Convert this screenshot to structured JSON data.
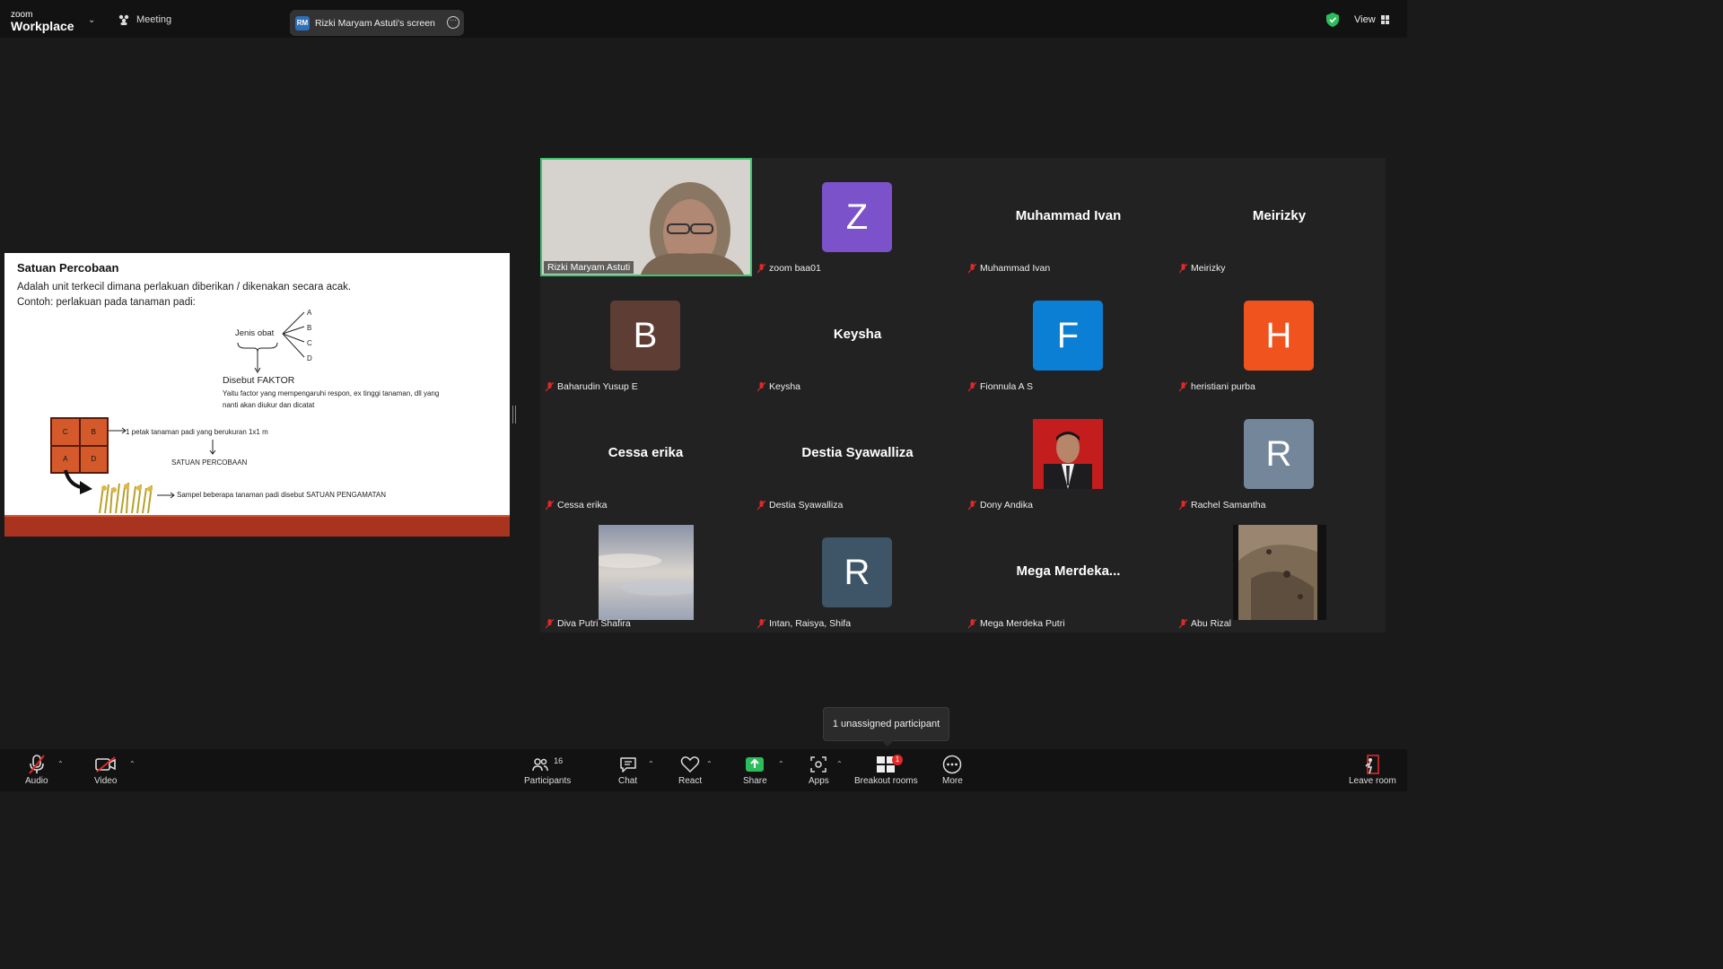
{
  "topbar": {
    "logo_small": "zoom",
    "logo_big": "Workplace",
    "meeting_label": "Meeting",
    "screen_badge": "RM",
    "screen_label": "Rizki Maryam Astuti's screen",
    "view_label": "View"
  },
  "slide": {
    "title": "Satuan Percobaan",
    "line1": "Adalah unit terkecil dimana perlakuan diberikan / dikenakan secara acak.",
    "line2": "Contoh: perlakuan pada tanaman padi:",
    "jenis_obat": "Jenis obat",
    "options": [
      "A",
      "B",
      "C",
      "D"
    ],
    "disebut_faktor": "Disebut FAKTOR",
    "faktor_desc1": "Yaitu factor yang mempengaruhi respon, ex tinggi tanaman, dll yang",
    "faktor_desc2": "nanti akan diukur dan dicatat",
    "plot_cells": [
      "C",
      "B",
      "A",
      "D"
    ],
    "petak_label": "1 petak tanaman padi yang berukuran 1x1 m",
    "satuan_percobaan": "SATUAN PERCOBAAN",
    "sampel_label": "Sampel beberapa tanaman padi disebut SATUAN PENGAMATAN"
  },
  "gallery": {
    "tiles": [
      {
        "name": "Rizki Maryam Astuti",
        "type": "video"
      },
      {
        "name": "zoom baa01",
        "avatar": "Z",
        "color": "#7b52c9"
      },
      {
        "name": "Muhammad Ivan",
        "display": "Muhammad Ivan"
      },
      {
        "name": "Meirizky",
        "display": "Meirizky"
      },
      {
        "name": "Baharudin Yusup E",
        "avatar": "B",
        "color": "#5e3e34"
      },
      {
        "name": "Keysha",
        "display": "Keysha"
      },
      {
        "name": "Fionnula A S",
        "avatar": "F",
        "color": "#0b7fd4"
      },
      {
        "name": "heristiani purba",
        "avatar": "H",
        "color": "#f0531e"
      },
      {
        "name": "Cessa erika",
        "display": "Cessa erika"
      },
      {
        "name": "Destia Syawalliza",
        "display": "Destia Syawalliza"
      },
      {
        "name": "Dony Andika",
        "type": "photo"
      },
      {
        "name": "Rachel Samantha",
        "avatar": "R",
        "color": "#73869a"
      },
      {
        "name": "Diva Putri Shafira",
        "type": "sky"
      },
      {
        "name": "Intan, Raisya, Shifa",
        "avatar": "R",
        "color": "#3d5566"
      },
      {
        "name": "Mega Merdeka Putri",
        "display": "Mega  Merdeka..."
      },
      {
        "name": "Abu Rizal",
        "type": "rock"
      }
    ]
  },
  "tooltip": "1 unassigned participant",
  "toolbar": {
    "audio": "Audio",
    "video": "Video",
    "participants": "Participants",
    "participants_count": "16",
    "chat": "Chat",
    "react": "React",
    "share": "Share",
    "apps": "Apps",
    "breakout": "Breakout rooms",
    "breakout_badge": "1",
    "more": "More",
    "leave": "Leave room"
  },
  "colors": {
    "active_speaker": "#3ec46d",
    "share_green": "#2bbd5a",
    "slide_footer": "#a8341f"
  }
}
